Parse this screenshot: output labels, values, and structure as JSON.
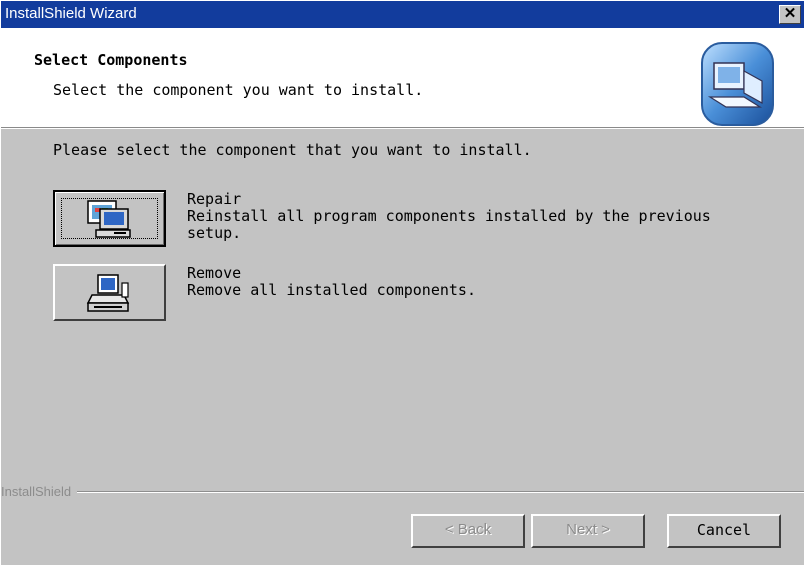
{
  "window": {
    "title": "InstallShield Wizard",
    "close_glyph": "✕"
  },
  "header": {
    "title": "Select Components",
    "subtitle": "Select the component you want to install.",
    "icon": "installer-computer-icon"
  },
  "main": {
    "prompt": "Please select the component that you want to install.",
    "options": [
      {
        "name": "Repair",
        "description_line1": "Reinstall all program components installed by the previous",
        "description_line2": "setup.",
        "icon": "repair-computer-icon",
        "focused": true
      },
      {
        "name": "Remove",
        "description_line1": "Remove all installed components.",
        "icon": "remove-computer-icon",
        "focused": false
      }
    ]
  },
  "footer": {
    "brand": "InstallShield",
    "back_label": "< Back",
    "next_label": "Next >",
    "cancel_label": "Cancel",
    "back_enabled": false,
    "next_enabled": false,
    "cancel_enabled": true
  },
  "colors": {
    "titlebar": "#123c9d",
    "dialog_face": "#c3c3c3",
    "header_bg": "#ffffff"
  }
}
